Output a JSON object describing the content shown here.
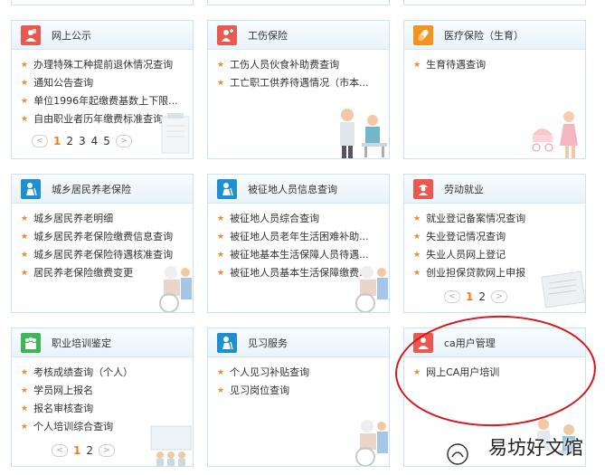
{
  "colors": {
    "accent_star": "#ef8a2b",
    "active_page": "#f07f14",
    "highlight_circle": "#d8161b",
    "icon_red": "#e85a50",
    "icon_orange": "#f4931e",
    "icon_blue": "#1e8fd0",
    "icon_green": "#3fb55a"
  },
  "top_strip": [
    {
      "text": ""
    },
    {
      "text": ""
    },
    {
      "text": ""
    }
  ],
  "cards": [
    {
      "title": "网上公示",
      "icon": "person-document-icon",
      "items": [
        "办理特殊工种提前退休情况查询",
        "通知公告查询",
        "单位1996年起缴费基数上下限...",
        "自由职业者历年缴费标准查询"
      ],
      "pager": {
        "prev": "<",
        "pages": [
          "1",
          "2",
          "3",
          "4",
          "5"
        ],
        "next": ">",
        "active": "1"
      }
    },
    {
      "title": "工伤保险",
      "icon": "injury-person-icon",
      "items": [
        "工伤人员伙食补助费查询",
        "工亡职工供养待遇情况（市本..."
      ]
    },
    {
      "title": "医疗保险（生育）",
      "icon": "medicine-icon",
      "items": [
        "生育待遇查询"
      ]
    },
    {
      "title": "城乡居民养老保险",
      "icon": "elder-person-icon",
      "items": [
        "城乡居民养老明细",
        "城乡居民养老保险缴费信息查询",
        "城乡居民养老保险待遇核准查询",
        "居民养老保险缴费变更"
      ]
    },
    {
      "title": "被征地人员信息查询",
      "icon": "land-person-icon",
      "items": [
        "被征地人员综合查询",
        "被征地人员老年生活困难补助...",
        "被征地基本生活保障人员待遇...",
        "被征地人员基本生活保障缴费..."
      ]
    },
    {
      "title": "劳动就业",
      "icon": "worker-icon",
      "items": [
        "就业登记备案情况查询",
        "失业登记情况查询",
        "失业人员网上登记",
        "创业担保贷款网上申报"
      ],
      "pager": {
        "prev": "<",
        "pages": [
          "1",
          "2"
        ],
        "next": ">",
        "active": "1"
      }
    },
    {
      "title": "职业培训鉴定",
      "icon": "training-group-icon",
      "items": [
        "考核成绩查询（个人）",
        "学员网上报名",
        "报名审核查询",
        "个人培训综合查询"
      ],
      "pager": {
        "prev": "<",
        "pages": [
          "1",
          "2"
        ],
        "next": ">",
        "active": "1"
      }
    },
    {
      "title": "见习服务",
      "icon": "intern-person-icon",
      "items": [
        "个人见习补贴查询",
        "见习岗位查询"
      ]
    },
    {
      "title": "ca用户管理",
      "icon": "ca-user-icon",
      "items": [
        "网上CA用户培训"
      ]
    }
  ],
  "watermark": "易坊好文馆"
}
